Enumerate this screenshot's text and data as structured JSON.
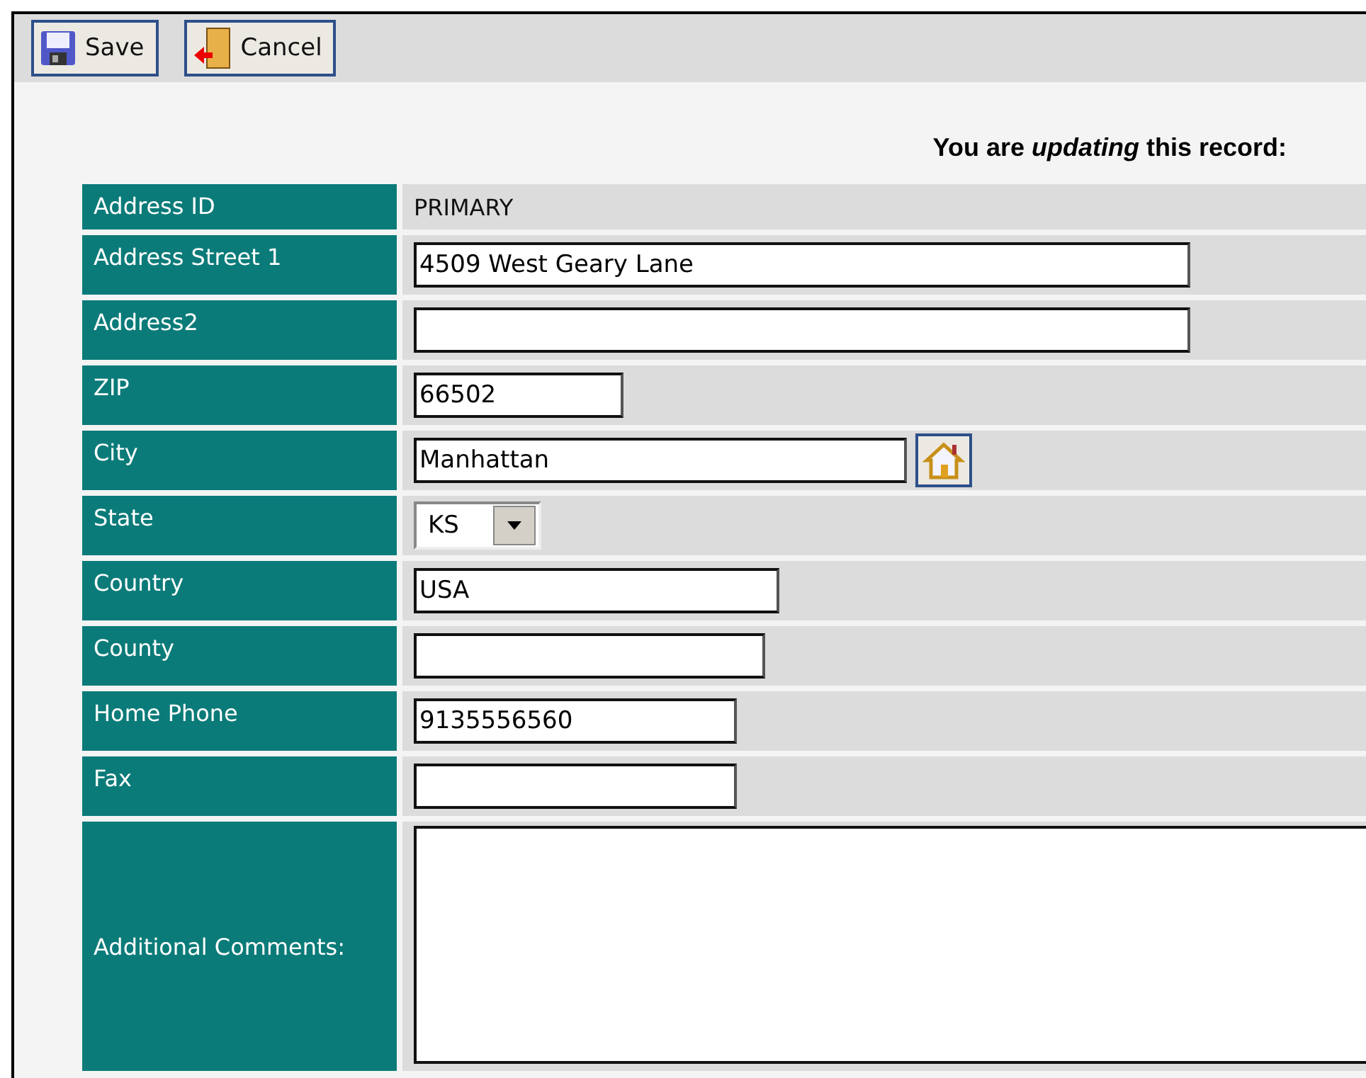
{
  "toolbar": {
    "buttons": [
      {
        "kind": "save",
        "label": "Save"
      },
      {
        "kind": "cancel",
        "label": "Cancel"
      }
    ]
  },
  "heading": "You are *updating* this record:",
  "fields": [
    {
      "kind": "static",
      "label": "Address ID",
      "value": "PRIMARY"
    },
    {
      "kind": "text",
      "label": "Address Street 1",
      "value": "4509 West Geary Lane"
    },
    {
      "kind": "text",
      "label": "Address2"
    },
    {
      "kind": "text",
      "label": "ZIP",
      "value": "66502"
    },
    {
      "kind": "lookup",
      "label": "City",
      "value": "Manhattan"
    },
    {
      "kind": "select",
      "label": "State",
      "value": "KS"
    },
    {
      "kind": "text",
      "label": "Country",
      "value": "USA"
    },
    {
      "kind": "text",
      "label": "County"
    },
    {
      "kind": "text",
      "label": "Home Phone",
      "value": "9135556560"
    },
    {
      "kind": "text",
      "label": "Fax"
    },
    {
      "kind": "textarea",
      "label": "Additional Comments:"
    }
  ]
}
